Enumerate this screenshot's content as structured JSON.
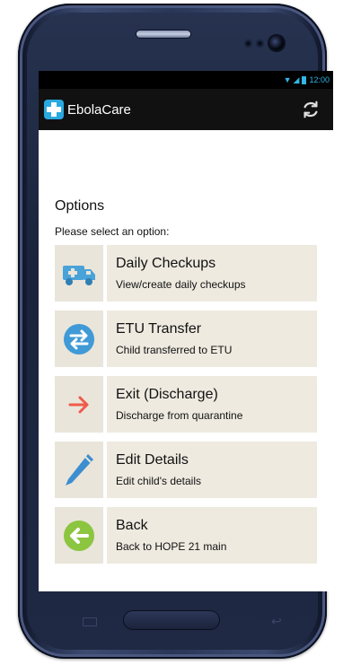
{
  "status_bar": {
    "time": "12:00",
    "wifi_icon": "wifi-icon",
    "signal_icon": "signal-icon",
    "battery_icon": "battery-icon"
  },
  "action_bar": {
    "title": "EbolaCare",
    "logo_icon": "medical-cross-icon",
    "refresh_icon": "refresh-icon"
  },
  "main": {
    "heading": "Options",
    "subheading": "Please select an option:",
    "options": [
      {
        "title": "Daily Checkups",
        "subtitle": "View/create daily checkups",
        "icon": "ambulance-icon",
        "color": "#4aa3d8"
      },
      {
        "title": "ETU Transfer",
        "subtitle": "Child transferred to ETU",
        "icon": "transfer-icon",
        "color": "#3f9ad6"
      },
      {
        "title": "Exit (Discharge)",
        "subtitle": "Discharge from quarantine",
        "icon": "arrow-right-icon",
        "color": "#f05a4a"
      },
      {
        "title": "Edit Details",
        "subtitle": "Edit child's details",
        "icon": "pencil-icon",
        "color": "#3d8ed0"
      },
      {
        "title": "Back",
        "subtitle": "Back to HOPE 21 main",
        "icon": "back-arrow-icon",
        "color": "#8cc53f"
      }
    ]
  },
  "colors": {
    "logo_blue": "#29a9df",
    "status_accent": "#33b5e5",
    "action_bar_bg": "#111111",
    "option_bg": "#eeeae0"
  }
}
